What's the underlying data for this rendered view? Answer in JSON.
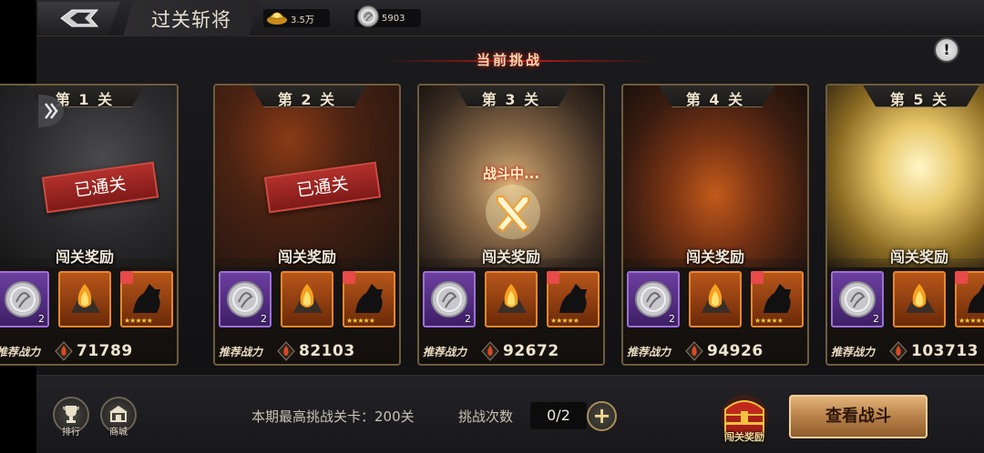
{
  "topbar": {
    "title": "过关斩将",
    "gold_amount": "3.5万",
    "silver_amount": "5903"
  },
  "header": {
    "title": "当前挑战"
  },
  "cards": [
    {
      "stage": "第 1 关",
      "status": "cleared",
      "status_text": "已通关",
      "reward_title": "闯关奖励",
      "item1_count": "2",
      "power_label": "推荐战力",
      "power": "71789"
    },
    {
      "stage": "第 2 关",
      "status": "cleared",
      "status_text": "已通关",
      "reward_title": "闯关奖励",
      "item1_count": "2",
      "power_label": "推荐战力",
      "power": "82103"
    },
    {
      "stage": "第 3 关",
      "status": "current",
      "status_text": "战斗中...",
      "reward_title": "闯关奖励",
      "item1_count": "2",
      "power_label": "推荐战力",
      "power": "92672"
    },
    {
      "stage": "第 4 关",
      "status": "locked",
      "status_text": "",
      "reward_title": "闯关奖励",
      "item1_count": "2",
      "power_label": "推荐战力",
      "power": "94926"
    },
    {
      "stage": "第 5 关",
      "status": "locked",
      "status_text": "",
      "reward_title": "闯关奖励",
      "item1_count": "2",
      "power_label": "推荐战力",
      "power": "103713"
    }
  ],
  "bottom": {
    "rank_label": "排行",
    "shop_label": "商城",
    "max_stage_text": "本期最高挑战关卡：200关",
    "attempts_label": "挑战次数",
    "attempts_value": "0/2",
    "plus_symbol": "+",
    "chest_label": "闯关奖励",
    "view_battle_label": "查看战斗"
  },
  "info_symbol": "!",
  "colors": {
    "accent_red": "#c5261c",
    "frame_gold": "#6f5c3c",
    "button_gold": "#b8814a"
  }
}
